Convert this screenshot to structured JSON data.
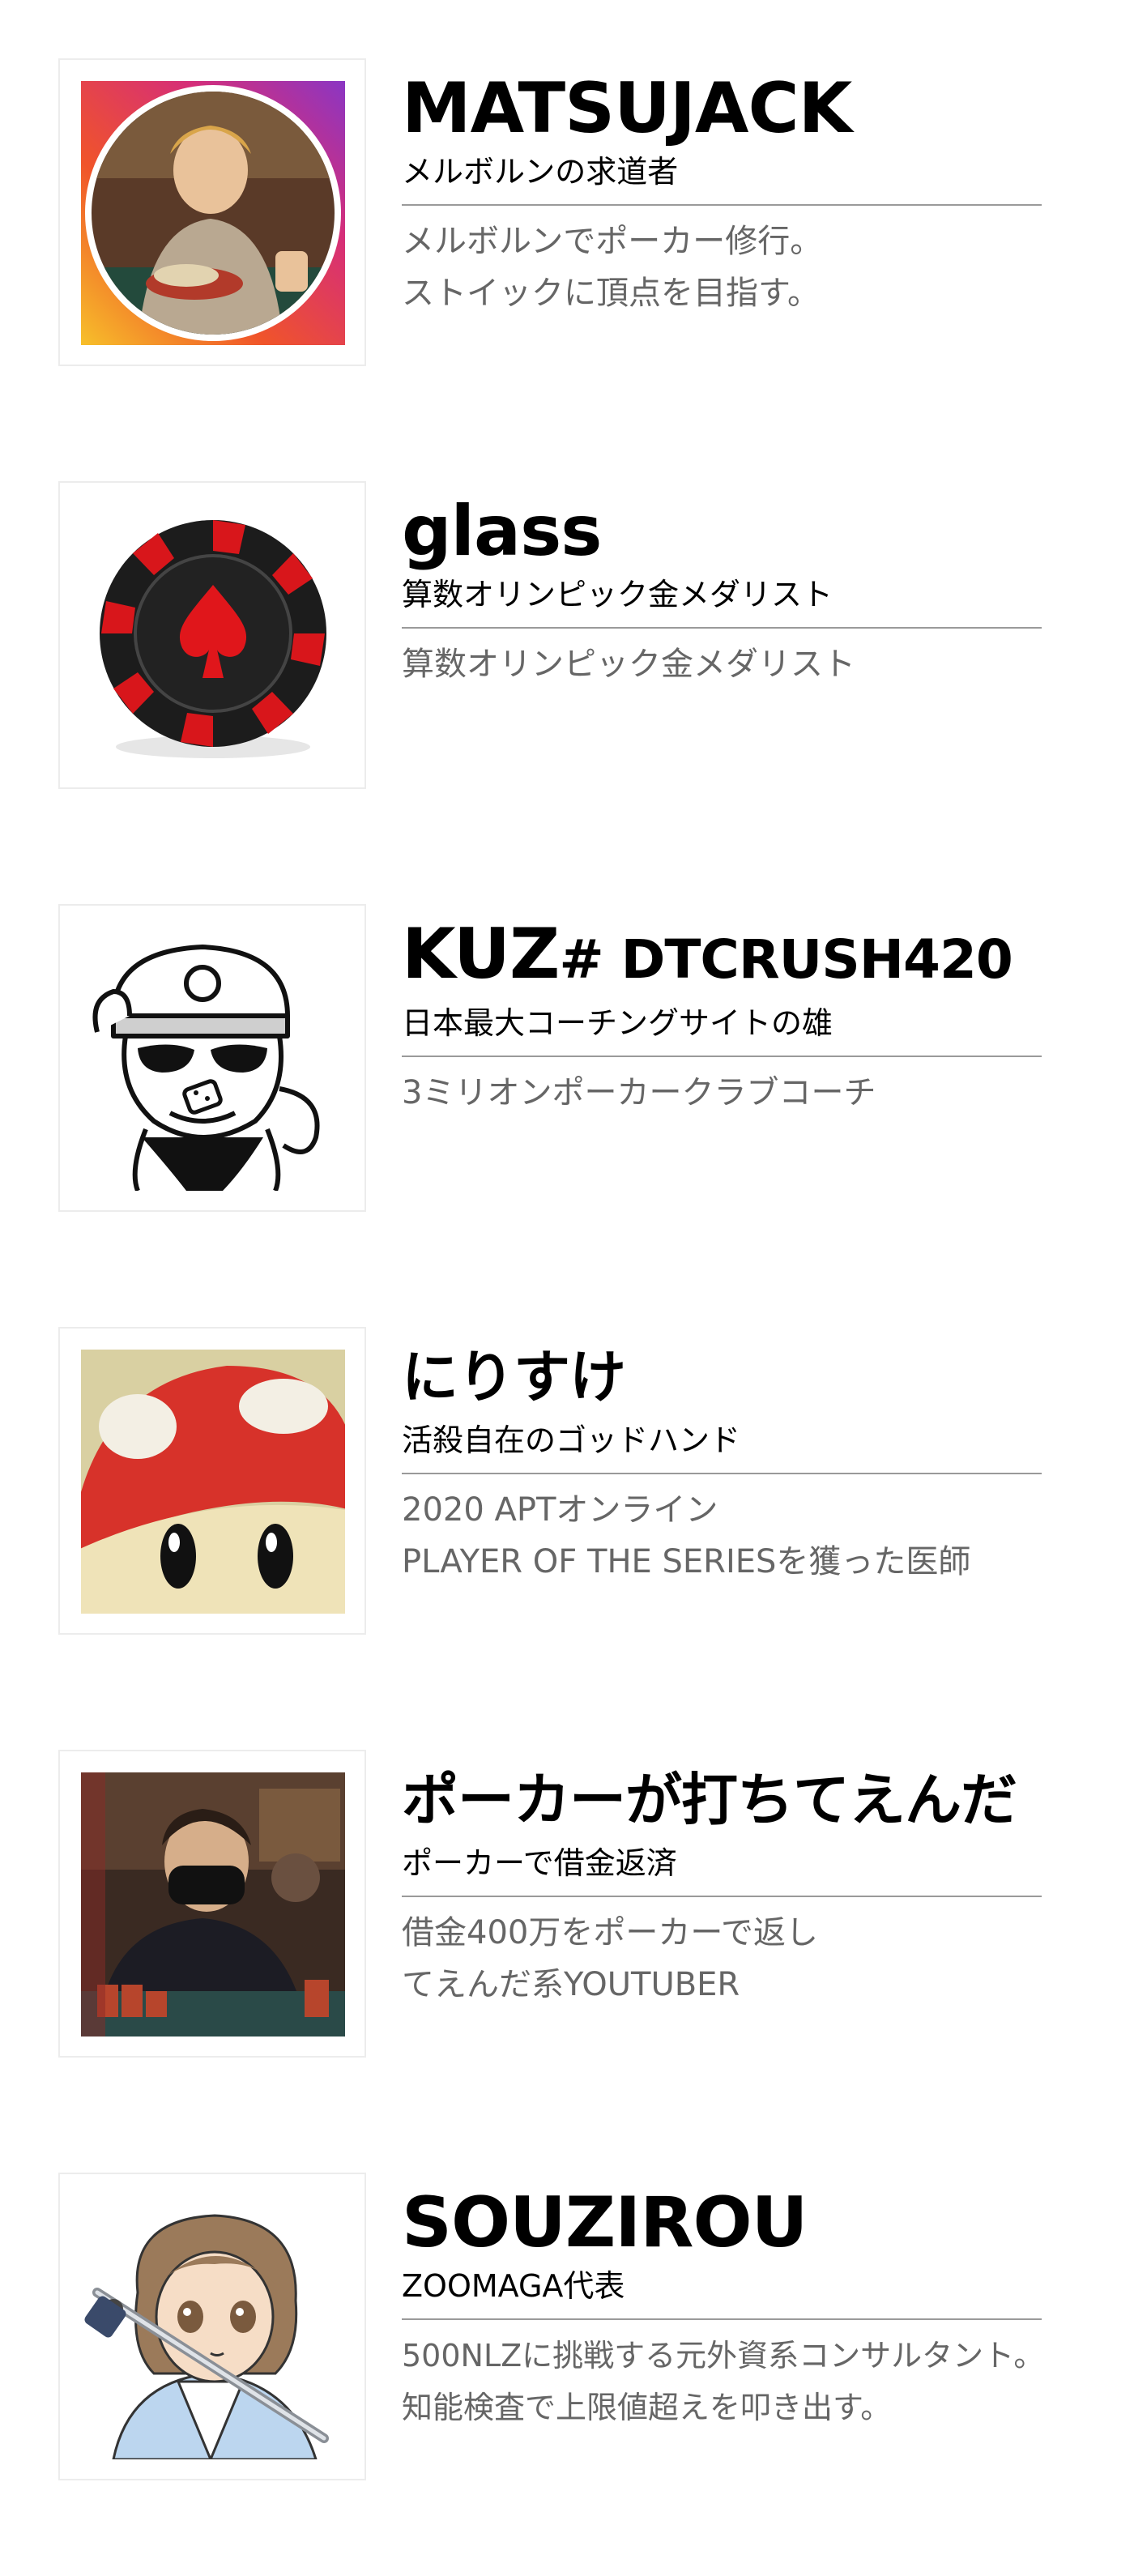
{
  "profiles": [
    {
      "name": "MATSUJACK",
      "name_suffix": "",
      "subtitle": "メルボルンの求道者",
      "description": "メルボルンでポーカー修行。\nストイックに頂点を目指す。",
      "avatar_icon": "instagram-style-portrait-avatar"
    },
    {
      "name": "glass",
      "name_suffix": "",
      "subtitle": "算数オリンピック金メダリスト",
      "description": "算数オリンピック金メダリスト",
      "avatar_icon": "poker-chip-spade-icon"
    },
    {
      "name": "KUZ",
      "name_suffix": "# DTCRUSH420",
      "subtitle": "日本最大コーチングサイトの雄",
      "description": "3ミリオンポーカークラブコーチ",
      "avatar_icon": "monkey-with-sunglasses-icon"
    },
    {
      "name": "にりすけ",
      "name_suffix": "",
      "subtitle": "活殺自在のゴッドハンド",
      "description": "2020 APTオンライン\nPLAYER OF THE SERIESを獲った医師",
      "avatar_icon": "mushroom-avatar"
    },
    {
      "name": "ポーカーが打ちてえんだ",
      "name_suffix": "",
      "subtitle": "ポーカーで借金返済",
      "description": "借金400万をポーカーで返し\nてえんだ系YOUTUBER",
      "avatar_icon": "masked-player-photo-avatar"
    },
    {
      "name": "SOUZIROU",
      "name_suffix": "",
      "subtitle": "ZOOMAGA代表",
      "description": "500NLZに挑戦する元外資系コンサルタント。\n知能検査で上限値超えを叩き出す。",
      "avatar_icon": "anime-samurai-avatar"
    }
  ]
}
